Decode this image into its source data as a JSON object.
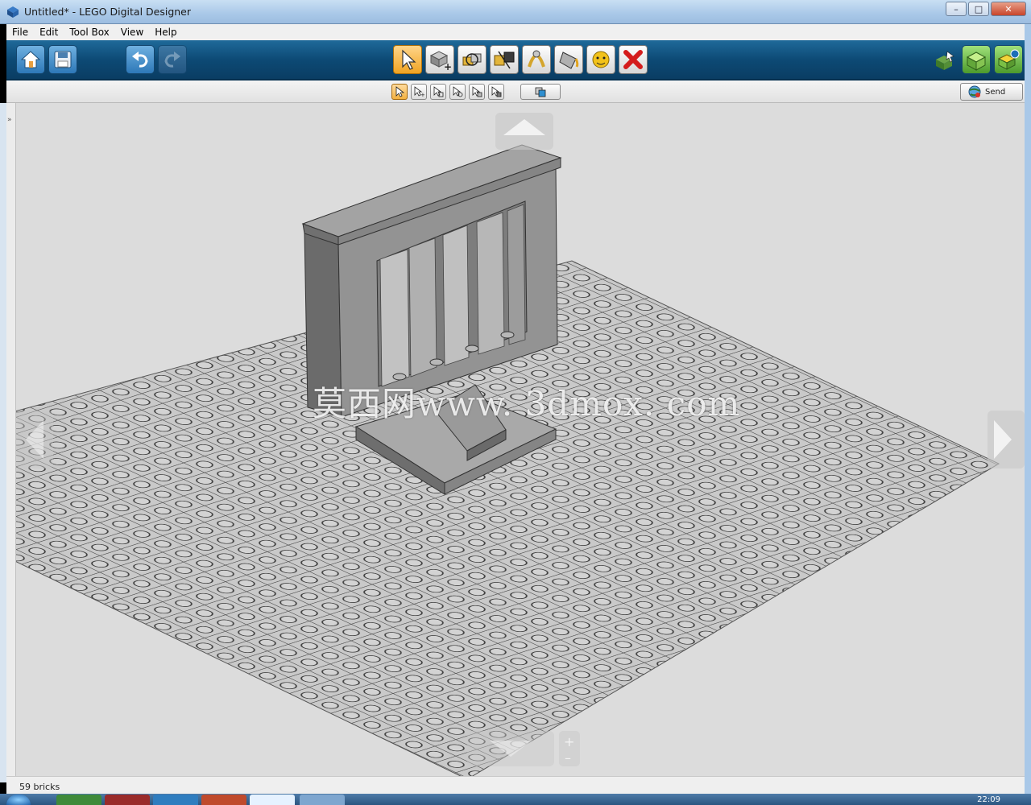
{
  "window": {
    "title": "Untitled* - LEGO Digital Designer",
    "minimize": "–",
    "maximize": "□",
    "close": "✕"
  },
  "menu": {
    "items": [
      {
        "label": "File"
      },
      {
        "label": "Edit"
      },
      {
        "label": "Tool Box"
      },
      {
        "label": "View"
      },
      {
        "label": "Help"
      }
    ]
  },
  "toolbar": {
    "left_buttons": [
      "home-icon",
      "save-icon",
      "undo-icon",
      "redo-icon"
    ],
    "tools": [
      "select-arrow-icon",
      "clone-brick-icon",
      "hinge-icon",
      "hinge-align-icon",
      "flex-icon",
      "paint-bucket-icon",
      "hide-icon",
      "delete-icon"
    ],
    "mode_buttons": [
      "build-mode-icon",
      "view-mode-icon",
      "building-guide-icon"
    ]
  },
  "subtoolbar": {
    "send_label": "Send"
  },
  "watermark": "莫西网www. 3dmox. com",
  "status": {
    "brick_count": "59 bricks"
  },
  "taskbar": {
    "clock": "22:09"
  },
  "colors": {
    "toolbar_blue": "#0d4a75",
    "active_tool": "#f0a423",
    "viewport_bg": "#dcdcdc",
    "baseplate": "#c8c8c8",
    "model_gray": "#8e8e8e"
  }
}
